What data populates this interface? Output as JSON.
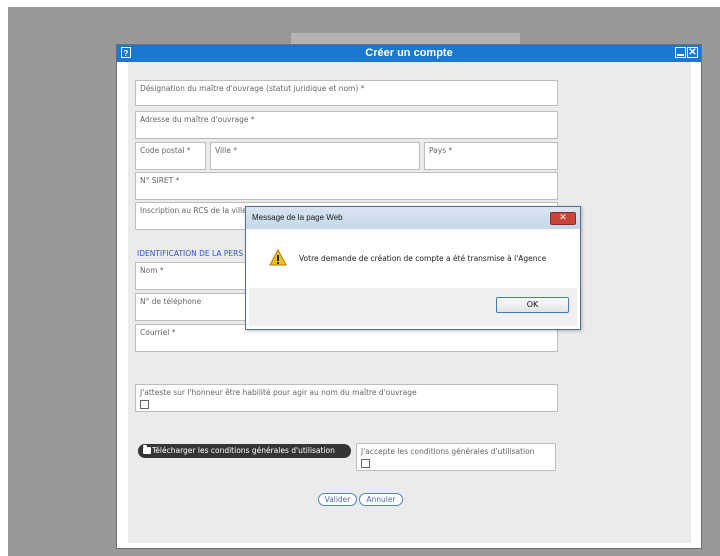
{
  "window": {
    "title": "Créer un compte",
    "help_glyph": "?",
    "close_glyph": "✕"
  },
  "form": {
    "designation": "Désignation du maître d'ouvrage (statut juridique et nom) *",
    "adresse": "Adresse du maître d'ouvrage *",
    "code_postal": "Code postal *",
    "ville": "Ville *",
    "pays": "Pays *",
    "siret": "N° SIRET *",
    "rcs": "Inscription au RCS de la ville",
    "section_title": "IDENTIFICATION DE LA PERS",
    "nom": "Nom *",
    "telephone": "N° de téléphone",
    "courriel": "Courriel *",
    "atteste": "J'atteste sur l'honneur être habilité pour agir au nom du maître d'ouvrage",
    "download_label": "Télécharger les conditions générales d'utilisation",
    "accept_cgu": "J'accepte les conditions générales d'utilisation",
    "valider": "Valider",
    "annuler": "Annuler"
  },
  "dialog": {
    "title": "Message de la page Web",
    "close_glyph": "✕",
    "message": "Votre demande de création de compte a été transmise à l'Agence",
    "ok_label": "OK"
  },
  "icons": {
    "help": "help-icon",
    "minimize": "minimize-icon",
    "close": "close-icon",
    "folder": "folder-icon",
    "warning": "warning-icon"
  },
  "colors": {
    "title_bar": "#1c78cf",
    "form_bg": "#ebebeb",
    "section_title": "#3355cc",
    "dialog_close": "#c9453a"
  }
}
